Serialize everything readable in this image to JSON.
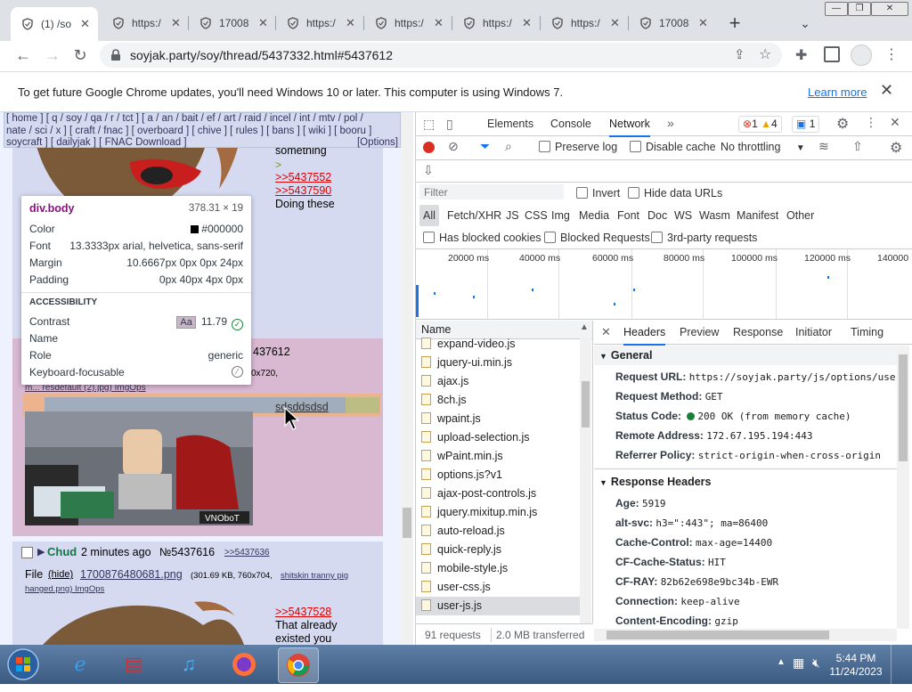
{
  "tabs": [
    {
      "title": "(1) /so",
      "active": true
    },
    {
      "title": "https:/"
    },
    {
      "title": "17008"
    },
    {
      "title": "https:/"
    },
    {
      "title": "https:/"
    },
    {
      "title": "https:/"
    },
    {
      "title": "https:/"
    },
    {
      "title": "17008"
    }
  ],
  "toolbar": {
    "url": "soyjak.party/soy/thread/5437332.html#5437612"
  },
  "infobar": {
    "text": "To get future Google Chrome updates, you'll need Windows 10 or later. This computer is using Windows 7.",
    "link": "Learn more"
  },
  "page": {
    "navbar_line1": "[ home ] [ q / soy / qa / r / tct ] [ a / an / bait / ef / art / raid / incel / int / mtv / pol /",
    "navbar_line2": "nate / sci / x ] [ craft / fnac ] [ overboard ] [ chive ] [ rules ] [ bans ] [ wiki ] [ booru ]",
    "navbar_line3": "soycraft ] [ dailyjak ] [ FNAC Download ]",
    "options": "[Options]",
    "post1_text1": "something",
    "post1_gt": ">",
    "post1_link1": ">>5437552",
    "post1_link2": ">>5437590",
    "post1_text2": "Doing these",
    "post2_no": "437612",
    "post2_dims": "0x720,",
    "post2_file": "m... resdefault (2).jpg) ImgOps",
    "post2_text": "sdsddsdsd",
    "post3_name": "Chud",
    "post3_time": "2 minutes ago",
    "post3_no": "№5437616",
    "post3_ref": ">>5437636",
    "post3_file_label": "File",
    "post3_hide": "(hide)",
    "post3_filename": "1700876480681.png",
    "post3_fileinfo": "(301.69 KB, 760x704,",
    "post3_fileorig": "shitskin tranny pig",
    "post3_fileorig2": "hanged.png) ImgOps",
    "post3_link": ">>5437528",
    "post3_text1": "That already",
    "post3_text2": "existed you"
  },
  "inspect": {
    "selector": "div.body",
    "size": "378.31 × 19",
    "rows": [
      {
        "k": "Color",
        "v": "#000000"
      },
      {
        "k": "Font",
        "v": "13.3333px arial, helvetica, sans-serif"
      },
      {
        "k": "Margin",
        "v": "10.6667px 0px 0px 24px"
      },
      {
        "k": "Padding",
        "v": "0px 40px 4px 0px"
      }
    ],
    "accessibility": "ACCESSIBILITY",
    "contrast_label": "Contrast",
    "contrast_aa": "Aa",
    "contrast_value": "11.79",
    "name_label": "Name",
    "role_label": "Role",
    "role_value": "generic",
    "kbd_label": "Keyboard-focusable"
  },
  "devtools": {
    "tabs": [
      "Elements",
      "Console",
      "Network"
    ],
    "errors": "1",
    "warnings": "4",
    "messages": "1",
    "preserve_log": "Preserve log",
    "disable_cache": "Disable cache",
    "throttling": "No throttling",
    "filter_placeholder": "Filter",
    "invert": "Invert",
    "hide_data": "Hide data URLs",
    "types": [
      "All",
      "Fetch/XHR",
      "JS",
      "CSS",
      "Img",
      "Media",
      "Font",
      "Doc",
      "WS",
      "Wasm",
      "Manifest",
      "Other"
    ],
    "blocked_cookies": "Has blocked cookies",
    "blocked_requests": "Blocked Requests",
    "third_party": "3rd-party requests",
    "timeline": [
      "20000 ms",
      "40000 ms",
      "60000 ms",
      "80000 ms",
      "100000 ms",
      "120000 ms",
      "140000"
    ],
    "name_header": "Name",
    "requests": [
      "expand-video.js",
      "jquery-ui.min.js",
      "ajax.js",
      "8ch.js",
      "wpaint.js",
      "upload-selection.js",
      "wPaint.min.js",
      "options.js?v1",
      "ajax-post-controls.js",
      "jquery.mixitup.min.js",
      "auto-reload.js",
      "quick-reply.js",
      "mobile-style.js",
      "user-css.js",
      "user-js.js"
    ],
    "status": "91 requests",
    "transferred": "2.0 MB transferred",
    "detail_tabs": [
      "Headers",
      "Preview",
      "Response",
      "Initiator",
      "Timing"
    ],
    "general": "General",
    "general_rows": [
      {
        "k": "Request URL:",
        "v": "https://soyjak.party/js/options/use"
      },
      {
        "k": "Request Method:",
        "v": "GET"
      },
      {
        "k": "Status Code:",
        "v": "200 OK (from memory cache)"
      },
      {
        "k": "Remote Address:",
        "v": "172.67.195.194:443"
      },
      {
        "k": "Referrer Policy:",
        "v": "strict-origin-when-cross-origin"
      }
    ],
    "response_headers": "Response Headers",
    "resp_rows": [
      {
        "k": "Age:",
        "v": "5919"
      },
      {
        "k": "alt-svc:",
        "v": "h3=\":443\"; ma=86400"
      },
      {
        "k": "Cache-Control:",
        "v": "max-age=14400"
      },
      {
        "k": "CF-Cache-Status:",
        "v": "HIT"
      },
      {
        "k": "CF-RAY:",
        "v": "82b62e698e9bc34b-EWR"
      },
      {
        "k": "Connection:",
        "v": "keep-alive"
      },
      {
        "k": "Content-Encoding:",
        "v": "gzip"
      }
    ]
  },
  "taskbar": {
    "time": "5:44 PM",
    "date": "11/24/2023"
  }
}
